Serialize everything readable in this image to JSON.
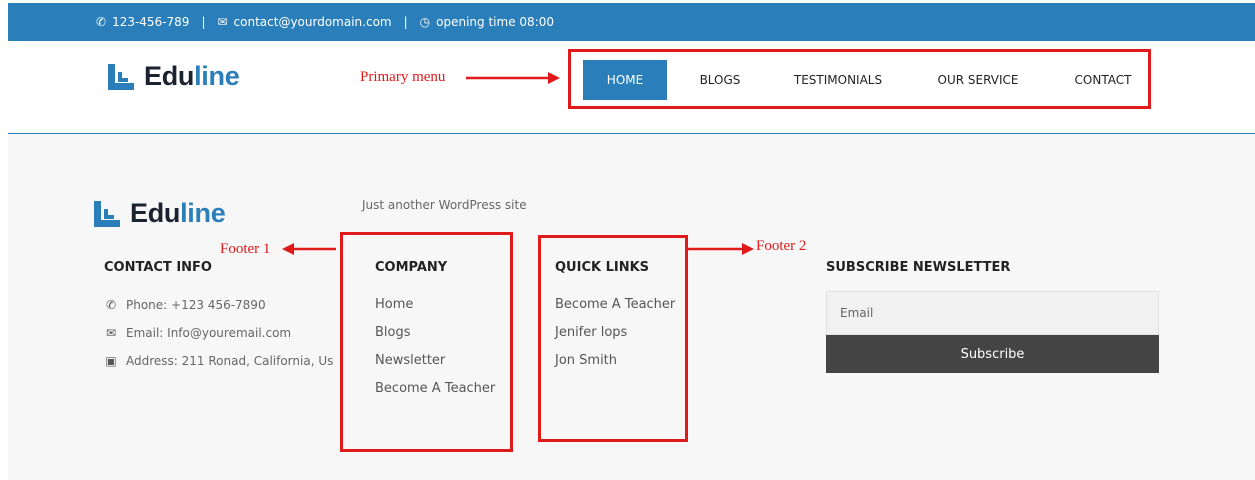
{
  "topbar": {
    "phone_icon": "phone-icon",
    "phone": "123-456-789",
    "sep1": "|",
    "email_icon": "envelope-icon",
    "email": "contact@yourdomain.com",
    "sep2": "|",
    "clock_icon": "clock-icon",
    "hours": "opening time 08:00"
  },
  "brand": {
    "part1": "Edu",
    "part2": "line"
  },
  "nav": {
    "items": [
      {
        "label": "HOME",
        "active": true
      },
      {
        "label": "BLOGS"
      },
      {
        "label": "TESTIMONIALS"
      },
      {
        "label": "OUR SERVICE"
      },
      {
        "label": "CONTACT"
      }
    ]
  },
  "annotations": {
    "primary_menu": "Primary menu",
    "footer1": "Footer 1",
    "footer2": "Footer 2"
  },
  "footer": {
    "tagline": "Just another WordPress site",
    "contact": {
      "title": "CONTACT INFO",
      "phone": "Phone: +123 456-7890",
      "email": "Email: Info@youremail.com",
      "address": "Address: 211 Ronad, California, Us"
    },
    "company": {
      "title": "COMPANY",
      "links": [
        "Home",
        "Blogs",
        "Newsletter",
        "Become A Teacher"
      ]
    },
    "quick_links": {
      "title": "QUICK LINKS",
      "links": [
        "Become A Teacher",
        "Jenifer lops",
        "Jon Smith"
      ]
    },
    "newsletter": {
      "title": "SUBSCRIBE NEWSLETTER",
      "email_placeholder": "Email",
      "button": "Subscribe"
    }
  },
  "colors": {
    "brand_blue": "#2a7fba",
    "annotation_red": "#e0191b",
    "button_dark": "#444444"
  }
}
